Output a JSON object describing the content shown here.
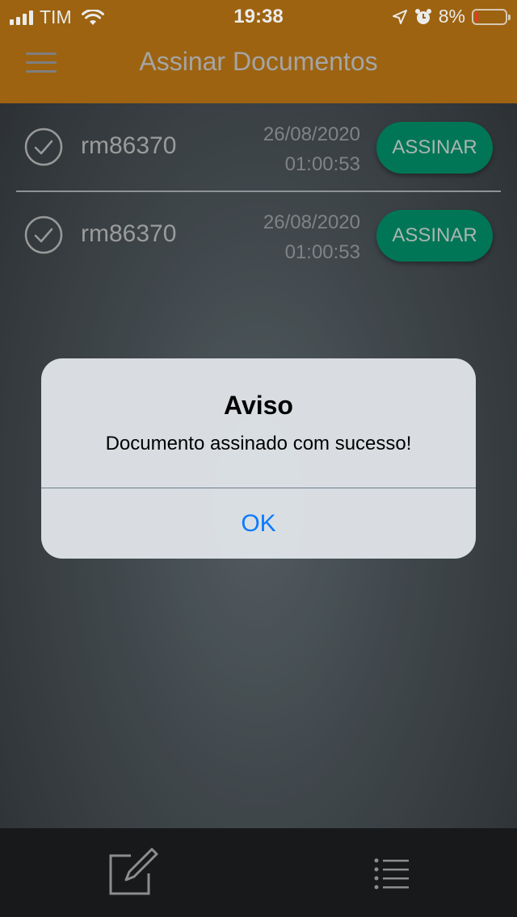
{
  "status_bar": {
    "carrier": "TIM",
    "time": "19:38",
    "battery": "8%",
    "icons": [
      "signal-bars-icon",
      "wifi-icon",
      "location-arrow-icon",
      "alarm-icon",
      "battery-icon"
    ]
  },
  "header": {
    "title": "Assinar Documentos",
    "menu_icon": "hamburger-menu-icon",
    "color": "#ab6c12"
  },
  "documents": [
    {
      "name": "rm86370",
      "date": "26/08/2020",
      "time": "01:00:53",
      "button": "ASSINAR",
      "icon": "check-circle-icon"
    },
    {
      "name": "rm86370",
      "date": "26/08/2020",
      "time": "01:00:53",
      "button": "ASSINAR",
      "icon": "check-circle-icon"
    }
  ],
  "alert": {
    "title": "Aviso",
    "message": "Documento assinado com sucesso!",
    "ok": "OK"
  },
  "tab_bar": {
    "items": [
      "edit-document-icon",
      "list-icon"
    ]
  },
  "colors": {
    "accent_button": "#00815e",
    "alert_button": "#0a7aff",
    "battery_low": "#ff3b30"
  }
}
